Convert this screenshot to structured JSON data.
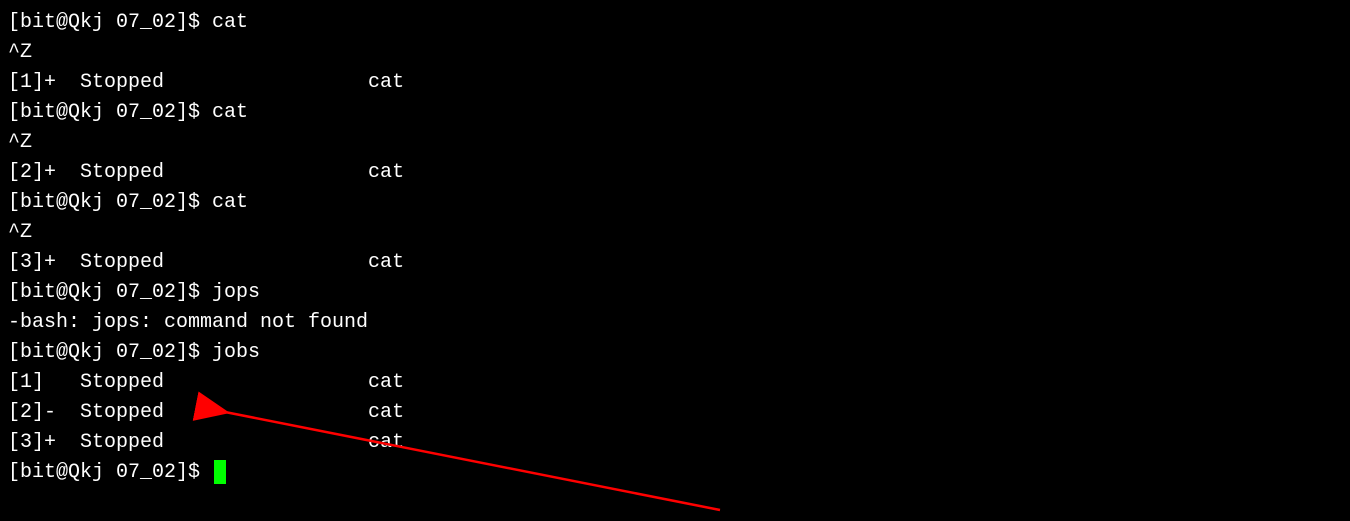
{
  "prompt": "[bit@Qkj 07_02]$ ",
  "lines": [
    "[bit@Qkj 07_02]$ cat",
    "^Z",
    "[1]+  Stopped                 cat",
    "[bit@Qkj 07_02]$ cat",
    "^Z",
    "[2]+  Stopped                 cat",
    "[bit@Qkj 07_02]$ cat",
    "^Z",
    "[3]+  Stopped                 cat",
    "[bit@Qkj 07_02]$ jops",
    "-bash: jops: command not found",
    "[bit@Qkj 07_02]$ jobs",
    "[1]   Stopped                 cat",
    "[2]-  Stopped                 cat",
    "[3]+  Stopped                 cat"
  ],
  "final_prompt": "[bit@Qkj 07_02]$ ",
  "annotation": {
    "color": "#ff0000"
  }
}
